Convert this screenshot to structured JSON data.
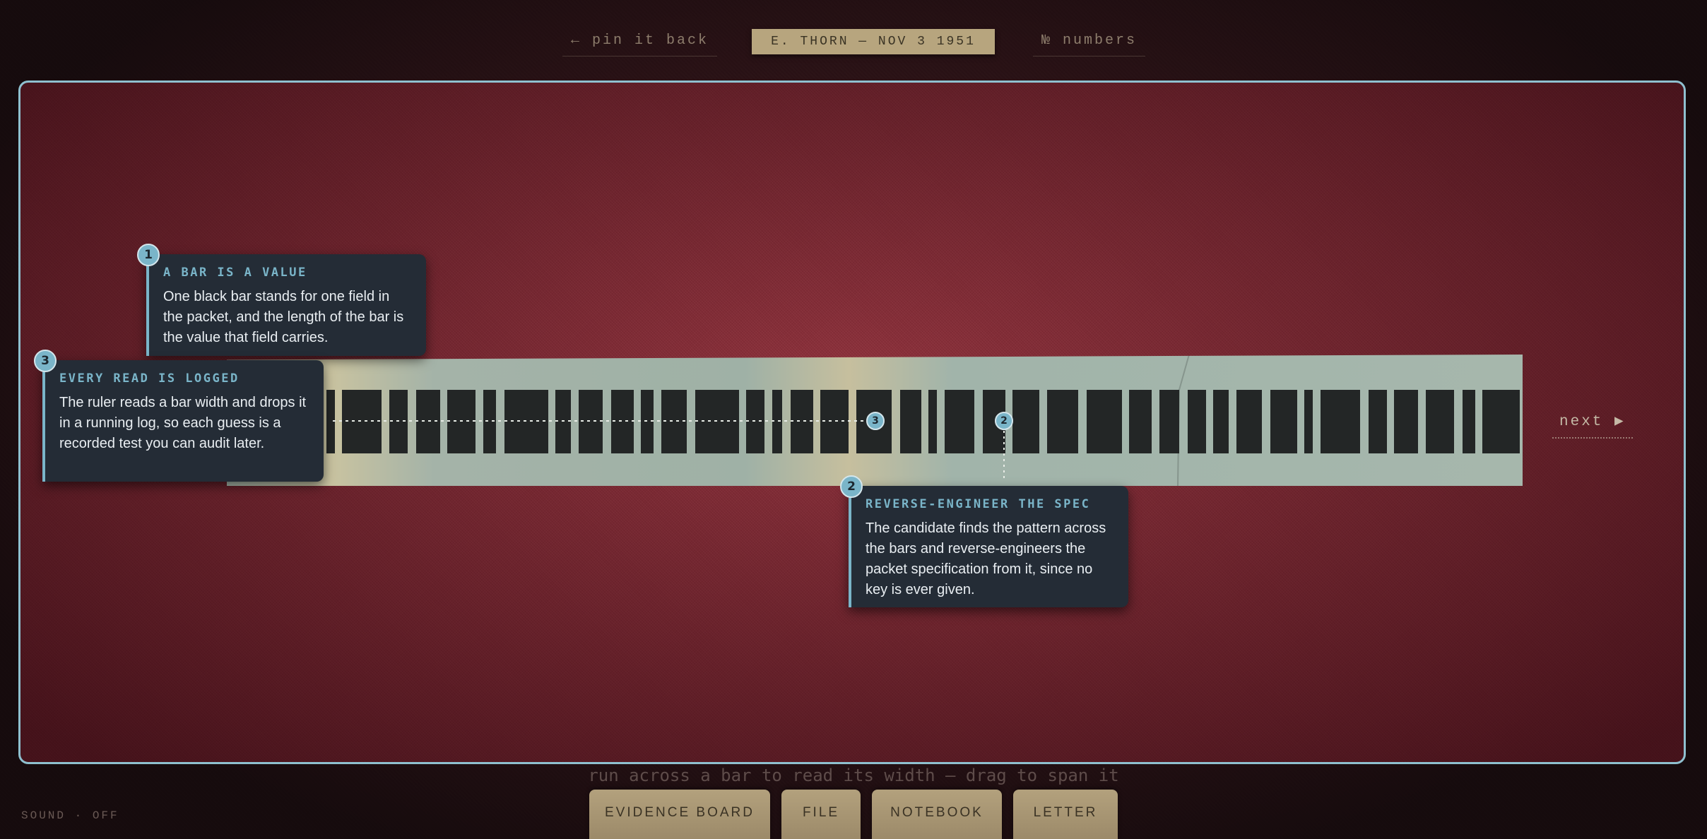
{
  "topnav": {
    "back_label": "← pin it back",
    "case_label": "E. THORN — NOV 3 1951",
    "numbers_label": "№ numbers"
  },
  "cards": [
    {
      "number": "1",
      "title": "A BAR IS A VALUE",
      "body": "One black bar stands for one field in the packet, and the length of the bar is the value that field carries."
    },
    {
      "number": "3",
      "title": "EVERY READ IS LOGGED",
      "body": "The ruler reads a bar width and drops it in a running log, so each guess is a recorded test you can audit later."
    },
    {
      "number": "2",
      "title": "REVERSE-ENGINEER THE SPEC",
      "body": "The candidate finds the pattern across the bars and reverse-engineers the packet specification from it, since no key is ever given."
    }
  ],
  "markers": {
    "ruler": "3",
    "pattern": "2"
  },
  "next_label": "next ▶",
  "hint": "run across a bar to read its width — drag to span it",
  "sound_label": "SOUND · OFF",
  "tabs": [
    "EVIDENCE BOARD",
    "FILE",
    "NOTEBOOK",
    "LETTER"
  ],
  "colors": {
    "accent": "#7ab5c9",
    "card_bg": "#242c36",
    "felt": "#7e2a34",
    "tab": "#a99775"
  }
}
